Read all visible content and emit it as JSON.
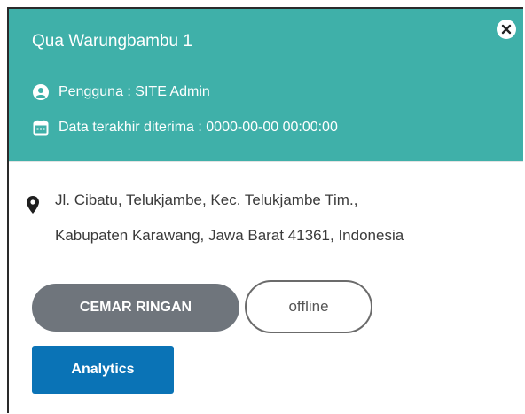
{
  "popup": {
    "title": "Qua Warungbambu 1",
    "user_label": "Pengguna : SITE Admin",
    "data_label": "Data terakhir diterima : 0000-00-00 00:00:00",
    "address_lines": [
      "Jl. Cibatu, Telukjambe, Kec. Telukjambe Tim.,",
      "Kabupaten Karawang, Jawa Barat 41361, Indonesia"
    ],
    "status_label": "CEMAR RINGAN",
    "connection_label": "offline",
    "analytics_label": "Analytics"
  },
  "icons": {
    "close": "close-icon",
    "user": "user-circle-icon",
    "calendar": "calendar-icon",
    "location": "map-pin-icon"
  },
  "colors": {
    "header_bg": "#3fb0a9",
    "status_pill": "#6f757c",
    "analytics_button": "#0a73b6"
  }
}
